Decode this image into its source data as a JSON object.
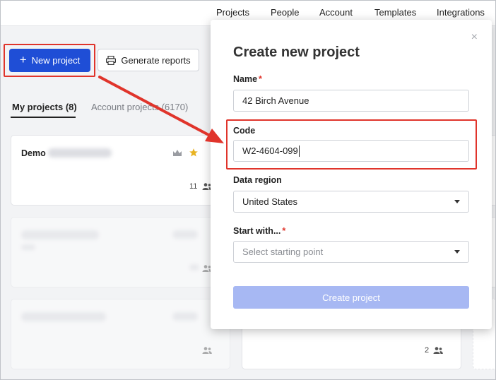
{
  "nav": {
    "items": [
      {
        "label": "Projects"
      },
      {
        "label": "People"
      },
      {
        "label": "Account"
      },
      {
        "label": "Templates"
      },
      {
        "label": "Integrations"
      }
    ]
  },
  "toolbar": {
    "new_project_label": "New project",
    "generate_reports_label": "Generate reports"
  },
  "tabs": {
    "my_projects": "My projects (8)",
    "account_projects": "Account projects (6170)"
  },
  "cards": {
    "demo_title": "Demo",
    "demo_member_count": "11",
    "bottom_member_count": "2"
  },
  "modal": {
    "title": "Create new project",
    "close_symbol": "×",
    "name_label": "Name",
    "name_value": "42 Birch Avenue",
    "code_label": "Code",
    "code_value": "W2-4604-099",
    "region_label": "Data region",
    "region_value": "United States",
    "start_label": "Start with...",
    "start_placeholder": "Select starting point",
    "required_mark": "*",
    "create_button_label": "Create project"
  },
  "colors": {
    "primary": "#1f4ed6",
    "disabled_primary": "#a7b8f3",
    "annotation_red": "#e0342b",
    "star": "#e8b321"
  }
}
